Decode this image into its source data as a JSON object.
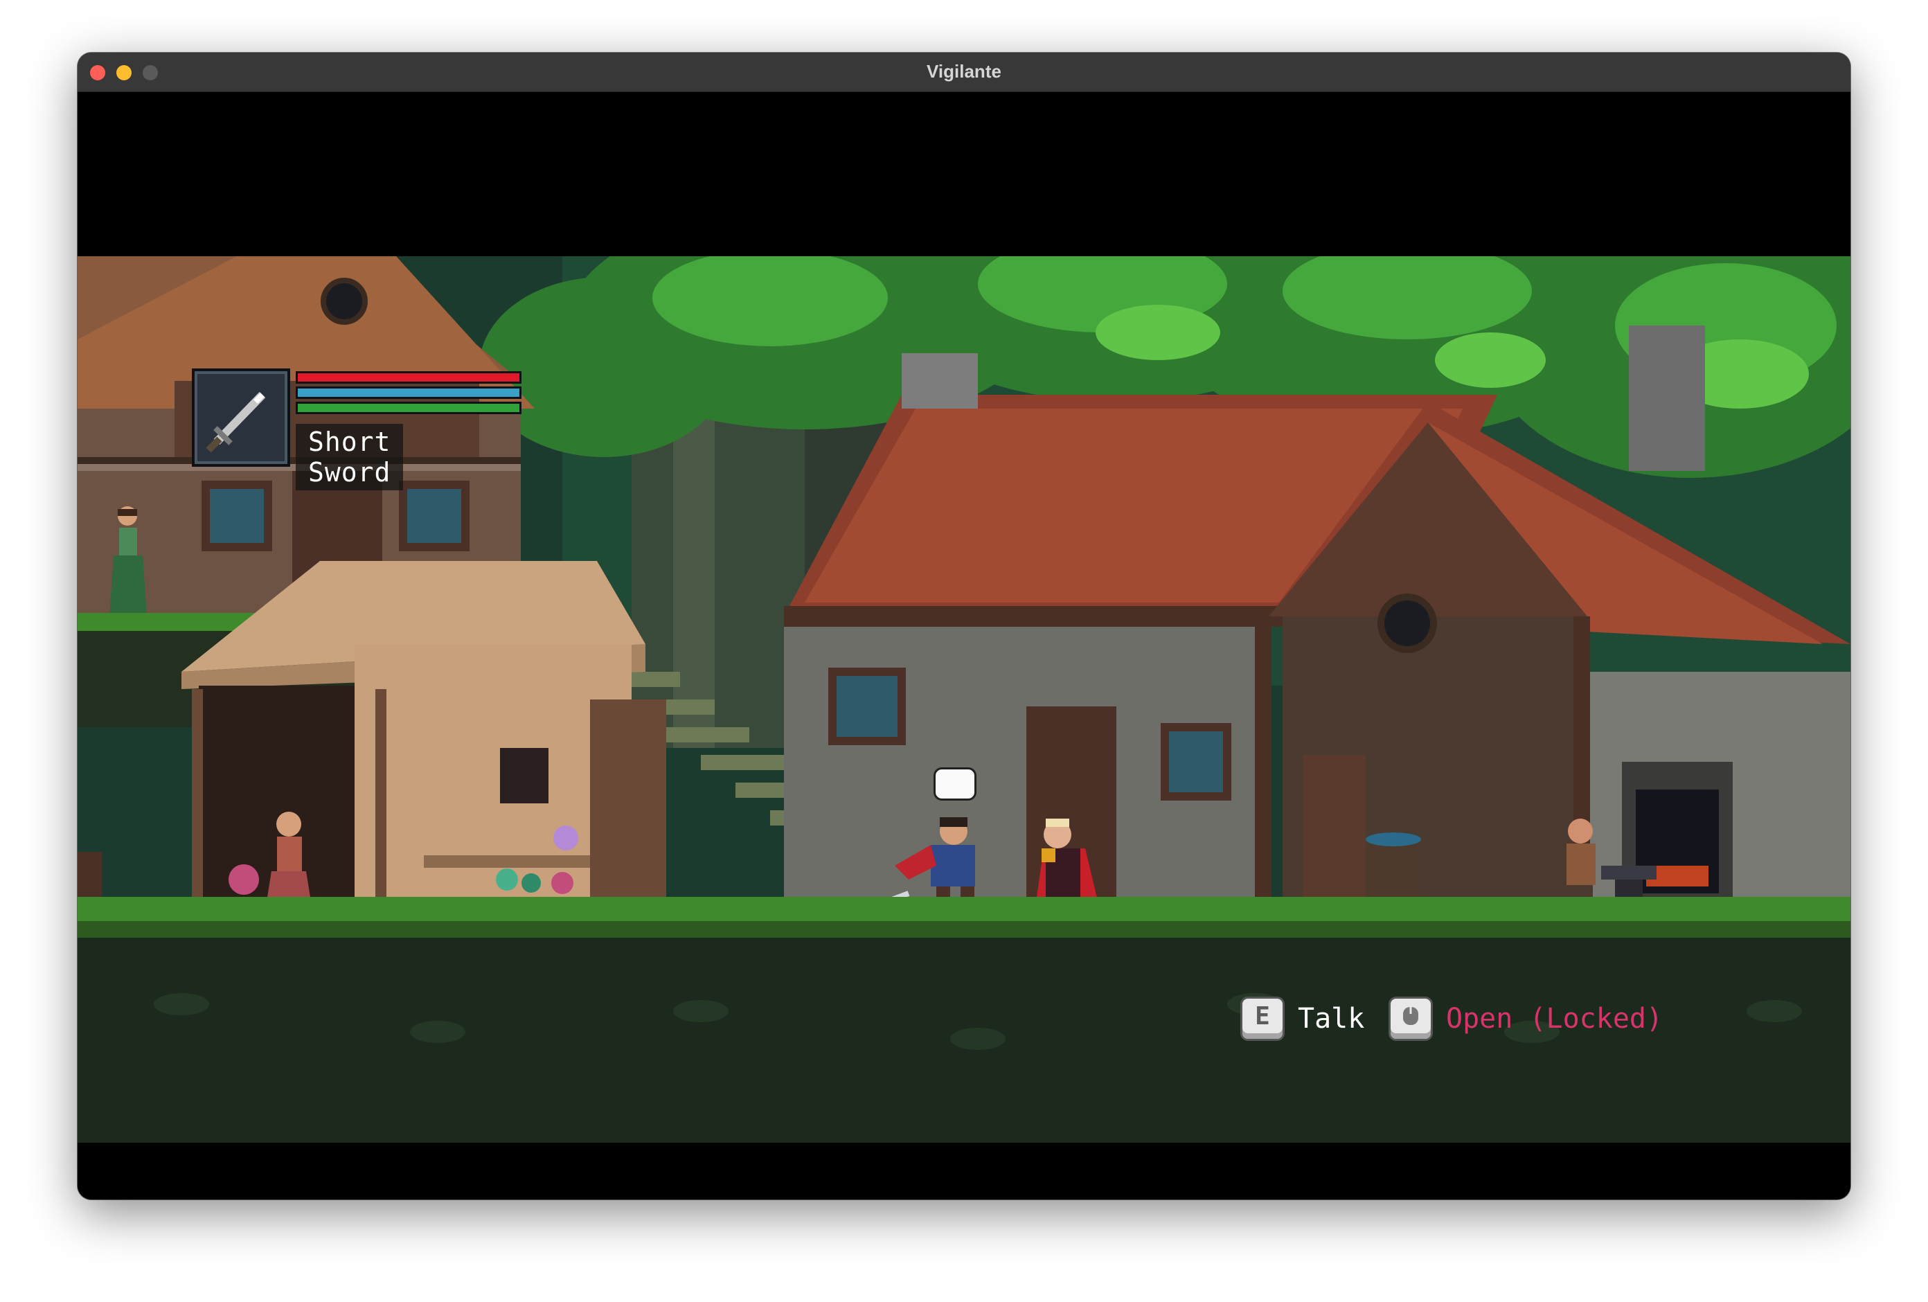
{
  "window": {
    "title": "Vigilante"
  },
  "hud": {
    "weapon_icon": "sword-icon",
    "weapon_name": "Short Sword",
    "health": 1.0,
    "mana": 1.0,
    "stamina": 1.0,
    "colors": {
      "health": "#e01a2b",
      "mana": "#3aa0c8",
      "stamina": "#2fa33a"
    }
  },
  "prompts": [
    {
      "key": "E",
      "label": "Talk",
      "color": "#ffffff"
    },
    {
      "key": "",
      "key_icon": "mouse-icon",
      "label": "Open (Locked)",
      "color": "#d8336b"
    }
  ],
  "speech_bubble": {
    "icon": "speech-bubble-icon"
  }
}
